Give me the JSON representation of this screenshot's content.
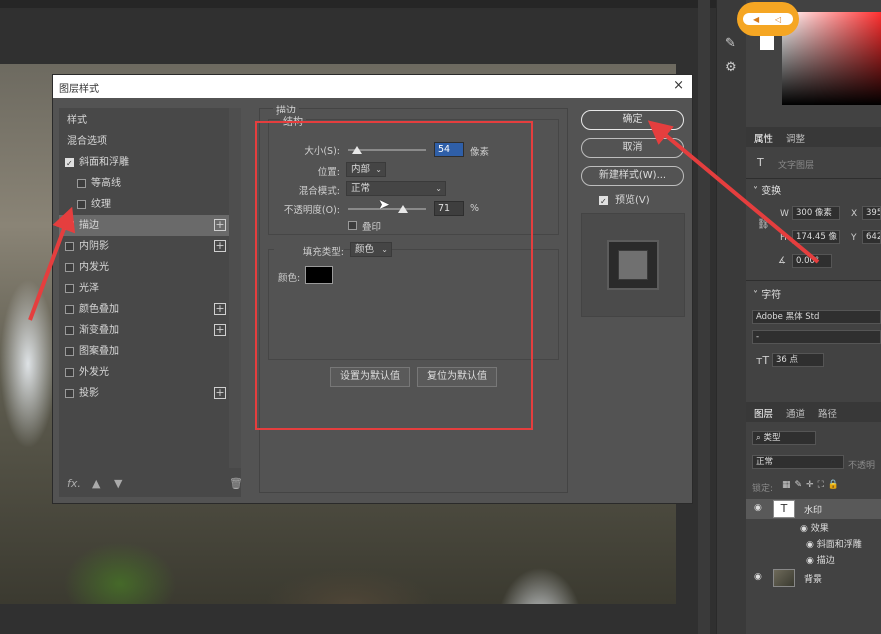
{
  "dialog": {
    "title": "图层样式",
    "close_glyph": "×",
    "styles_header": "样式",
    "blend_options": "混合选项",
    "style_items": [
      {
        "label": "斜面和浮雕",
        "checked": true,
        "indent": false,
        "plus": false
      },
      {
        "label": "等高线",
        "checked": false,
        "indent": true,
        "plus": false
      },
      {
        "label": "纹理",
        "checked": false,
        "indent": true,
        "plus": false
      },
      {
        "label": "描边",
        "checked": true,
        "indent": false,
        "plus": true,
        "selected": true
      },
      {
        "label": "内阴影",
        "checked": false,
        "indent": false,
        "plus": true
      },
      {
        "label": "内发光",
        "checked": false,
        "indent": false,
        "plus": false
      },
      {
        "label": "光泽",
        "checked": false,
        "indent": false,
        "plus": false
      },
      {
        "label": "颜色叠加",
        "checked": false,
        "indent": false,
        "plus": true
      },
      {
        "label": "渐变叠加",
        "checked": false,
        "indent": false,
        "plus": true
      },
      {
        "label": "图案叠加",
        "checked": false,
        "indent": false,
        "plus": false
      },
      {
        "label": "外发光",
        "checked": false,
        "indent": false,
        "plus": false
      },
      {
        "label": "投影",
        "checked": false,
        "indent": false,
        "plus": true
      }
    ],
    "footer_fx": "fx.",
    "stroke": {
      "group_title": "描边",
      "structure_title": "结构",
      "size_label": "大小(S):",
      "size_value": "54",
      "size_unit": "像素",
      "position_label": "位置:",
      "position_value": "内部",
      "blend_mode_label": "混合模式:",
      "blend_mode_value": "正常",
      "opacity_label": "不透明度(O):",
      "opacity_value": "71",
      "opacity_unit": "%",
      "overprint_label": "叠印",
      "fill_type_label": "填充类型:",
      "fill_type_value": "颜色",
      "color_label": "颜色:",
      "color_value": "#000000",
      "size_slider_fraction": 0.12,
      "opacity_slider_fraction": 0.71
    },
    "set_default_label": "设置为默认值",
    "reset_default_label": "复位为默认值",
    "ok_label": "确定",
    "cancel_label": "取消",
    "new_style_label": "新建样式(W)...",
    "preview_label": "预览(V)",
    "preview_checked": true
  },
  "properties": {
    "tab_properties": "属性",
    "tab_adjust": "调整",
    "layer_type": "文字图层",
    "transform_title": "变换",
    "w_label": "W",
    "w_value": "300 像素",
    "h_label": "H",
    "h_value": "174.45 像",
    "x_label": "X",
    "x_value": "395",
    "y_label": "Y",
    "y_value": "642",
    "angle_value": "0.00°",
    "char_title": "字符",
    "font_name": "Adobe 黑体 Std",
    "font_style": "-",
    "font_size": "36 点"
  },
  "layers": {
    "tab_layers": "图层",
    "tab_channels": "通道",
    "tab_paths": "路径",
    "filter_placeholder": "类型",
    "blend_mode": "正常",
    "opacity_label": "不透明",
    "lock_label": "锁定:",
    "items": [
      {
        "name": "水印",
        "thumb": "T"
      },
      {
        "name": "背景",
        "thumb": ""
      }
    ],
    "effects_label": "效果",
    "effect_items": [
      "斜面和浮雕",
      "描边"
    ]
  },
  "colors": {
    "annotation_red": "#e53e3e",
    "selection_blue": "#2f5fa8"
  }
}
